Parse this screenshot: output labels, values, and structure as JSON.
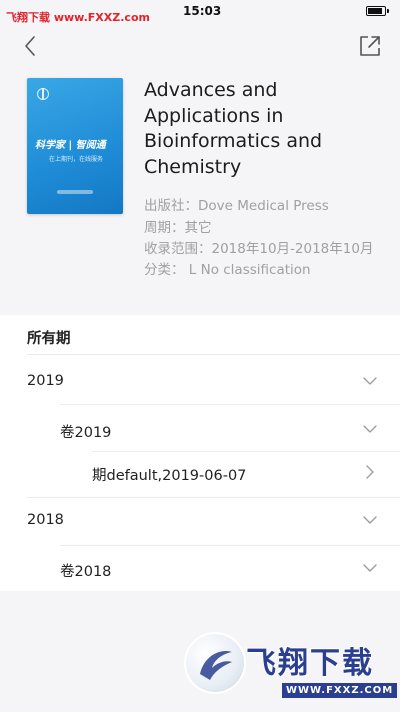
{
  "status_bar": {
    "watermark": "飞翔下载 www.FXXZ.com",
    "time": "15:03",
    "battery_level": 0.9
  },
  "nav": {
    "back_icon": "chevron-left-icon",
    "share_icon": "share-icon"
  },
  "journal": {
    "title": "Advances and Applications in Bioinformatics and Chemistry",
    "publisher": "出版社：Dove Medical Press",
    "period": "周期：其它",
    "range": "收录范围：2018年10月-2018年10月",
    "classification": "分类： L No classification",
    "cover": {
      "title": "科学家 | 智阅通",
      "subtitle": "在上期刊，在线服务"
    }
  },
  "issues": {
    "section_title": "所有期",
    "items": [
      {
        "label": "2019",
        "icon": "chevron-down-icon"
      },
      {
        "label": "卷2019",
        "icon": "chevron-down-icon"
      },
      {
        "label": "期default,2019-06-07",
        "icon": "chevron-right-icon"
      },
      {
        "label": "2018",
        "icon": "chevron-down-icon"
      },
      {
        "label": "卷2018",
        "icon": "chevron-down-icon"
      }
    ]
  },
  "bottom_watermark": {
    "text": "飞翔下载",
    "url": "WWW.FXXZ.COM"
  },
  "colors": {
    "background": "#f5f5f7",
    "panel": "#ffffff",
    "cover_blue": "#1e8bd6",
    "meta_gray": "#a0a0a4",
    "watermark_red": "#e0242b",
    "watermark_blue": "#2a3f8f"
  }
}
